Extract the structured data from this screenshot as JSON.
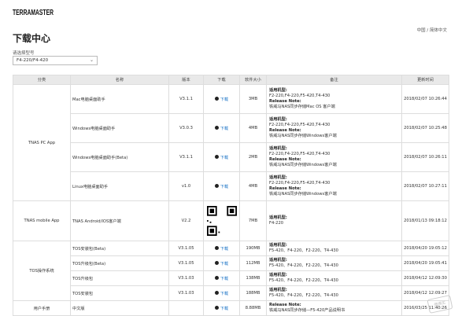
{
  "brand": {
    "logo_text": "TERRAMASTER"
  },
  "header": {
    "language": "中国 / 简体中文",
    "title": "下载中心"
  },
  "selector": {
    "label": "请选择型号",
    "value": "F4-220/F4-420"
  },
  "table": {
    "columns": [
      "分类",
      "名称",
      "版本",
      "下载",
      "软件大小",
      "备注",
      "更新时间"
    ],
    "groups": [
      {
        "category": "TNAS PC App",
        "rows": [
          {
            "name": "Mac电脑桌面助手",
            "version": "V3.1.1",
            "download": "下载",
            "size": "3MB",
            "remark": [
              "适用机型:",
              "F2-220,F4-220,F5-420,T4-430",
              "Release Note:",
              "铁威马NAS同步存储Mac OS 客户端"
            ],
            "updated": "2018/02/07 10:26:44"
          },
          {
            "name": "Windows电脑桌面助手",
            "version": "V3.0.3",
            "download": "下载",
            "size": "4MB",
            "remark": [
              "适用机型:",
              "F2-220,F4-220,F5-420,T4-430",
              "Release Note:",
              "铁威马NAS同步存储Windows客户端"
            ],
            "updated": "2018/02/07 10:25:48"
          },
          {
            "name": "Windows电脑桌面助手(Beta)",
            "version": "V3.1.1",
            "download": "下载",
            "size": "2MB",
            "remark": [
              "适用机型:",
              "F2-220,F4-220,F5-420,T4-430",
              "Release Note:",
              "铁威马NAS同步存储Windows客户端"
            ],
            "updated": "2018/02/07 10:26:11"
          },
          {
            "name": "Linux电脑桌面助手",
            "version": "v1.0",
            "download": "下载",
            "size": "4MB",
            "remark": [
              "适用机型:",
              "F2-220,F4-220,F5-420,T4-430",
              "Release Note:",
              "铁威马NAS同步存储Windows客户端"
            ],
            "updated": "2018/02/07 10:27:11"
          }
        ]
      },
      {
        "category": "TNAS mobile App",
        "rows": [
          {
            "name": "TNAS Android/IOS客户端",
            "version": "V2.2",
            "download": "qr",
            "size": "7MB",
            "remark": [
              "适用机型:",
              "F4-220"
            ],
            "updated": "2018/01/13 09:18:12"
          }
        ]
      },
      {
        "category": "TOS操作系统",
        "rows": [
          {
            "name": "TOS安装包(Beta)",
            "version": "V3.1.05",
            "download": "下载",
            "size": "190MB",
            "remark": [
              "适用机型:",
              "F5-420、F4-220、F2-220、T4-430"
            ],
            "updated": "2018/04/20 19:05:12"
          },
          {
            "name": "TOS升级包(Beta)",
            "version": "V3.1.05",
            "download": "下载",
            "size": "112MB",
            "remark": [
              "适用机型:",
              "F5-420、F4-220、F2-220、T4-430"
            ],
            "updated": "2018/04/20 19:05:41"
          },
          {
            "name": "TOS升级包",
            "version": "V3.1.03",
            "download": "下载",
            "size": "138MB",
            "remark": [
              "适用机型:",
              "F5-420、F4-220、F2-220、T4-430"
            ],
            "updated": "2018/04/12 12:09:30"
          },
          {
            "name": "TOS安装包",
            "version": "V3.1.03",
            "download": "下载",
            "size": "188MB",
            "remark": [
              "适用机型:",
              "F5-420、F4-220、F2-220、T4-430"
            ],
            "updated": "2018/04/12 12:09:27"
          }
        ]
      },
      {
        "category": "用户手册",
        "rows": [
          {
            "name": "中文版",
            "version": "",
            "download": "下载",
            "size": "8.88MB",
            "remark": [
              "Release Note:",
              "铁威马NAS同步存储—F5-420产品说明书"
            ],
            "updated": "2016/03/25 11:40:26"
          }
        ]
      }
    ]
  },
  "watermark": "值得买"
}
